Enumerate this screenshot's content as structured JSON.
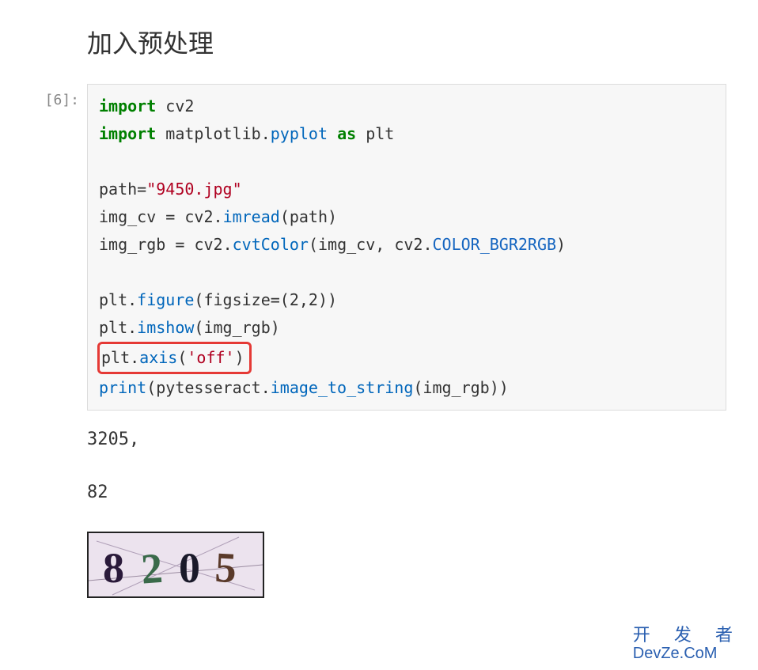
{
  "heading": "加入预处理",
  "cell": {
    "prompt": "[6]:",
    "code": {
      "kw_import1": "import",
      "mod_cv2": "cv2",
      "kw_import2": "import",
      "mod_mpl": "matplotlib",
      "func_pyplot": "pyplot",
      "kw_as": "as",
      "alias_plt": "plt",
      "var_path": "path",
      "eq1": "=",
      "str_path": "\"9450.jpg\"",
      "var_imgcv": "img_cv",
      "eq2": "=",
      "cv2_a": "cv2",
      "func_imread": "imread",
      "arg_path": "(path)",
      "var_imgrgb": "img_rgb",
      "eq3": "=",
      "cv2_b": "cv2",
      "func_cvtcolor": "cvtColor",
      "open_p": "(",
      "arg_imgcv": "img_cv",
      "comma1": ", ",
      "cv2_c": "cv2",
      "const_bgr2rgb": "COLOR_BGR2RGB",
      "close_p": ")",
      "plt1": "plt",
      "func_figure": "figure",
      "figargs": "(figsize=(2,2))",
      "plt2": "plt",
      "func_imshow": "imshow",
      "imshowargs": "(img_rgb)",
      "plt3": "plt",
      "func_axis": "axis",
      "open_p2": "(",
      "str_off": "'off'",
      "close_p2": ")",
      "func_print": "print",
      "open_p3": "(",
      "pytess": "pytesseract",
      "func_img2str": "image_to_string",
      "arg_imgrgb": "(img_rgb)",
      "close_p3": ")"
    }
  },
  "output": {
    "line1": "3205,",
    "line2": "82"
  },
  "captcha": {
    "text": "8205"
  },
  "watermark": {
    "cn": "开 发 者",
    "en": "DevZe.CoM"
  }
}
